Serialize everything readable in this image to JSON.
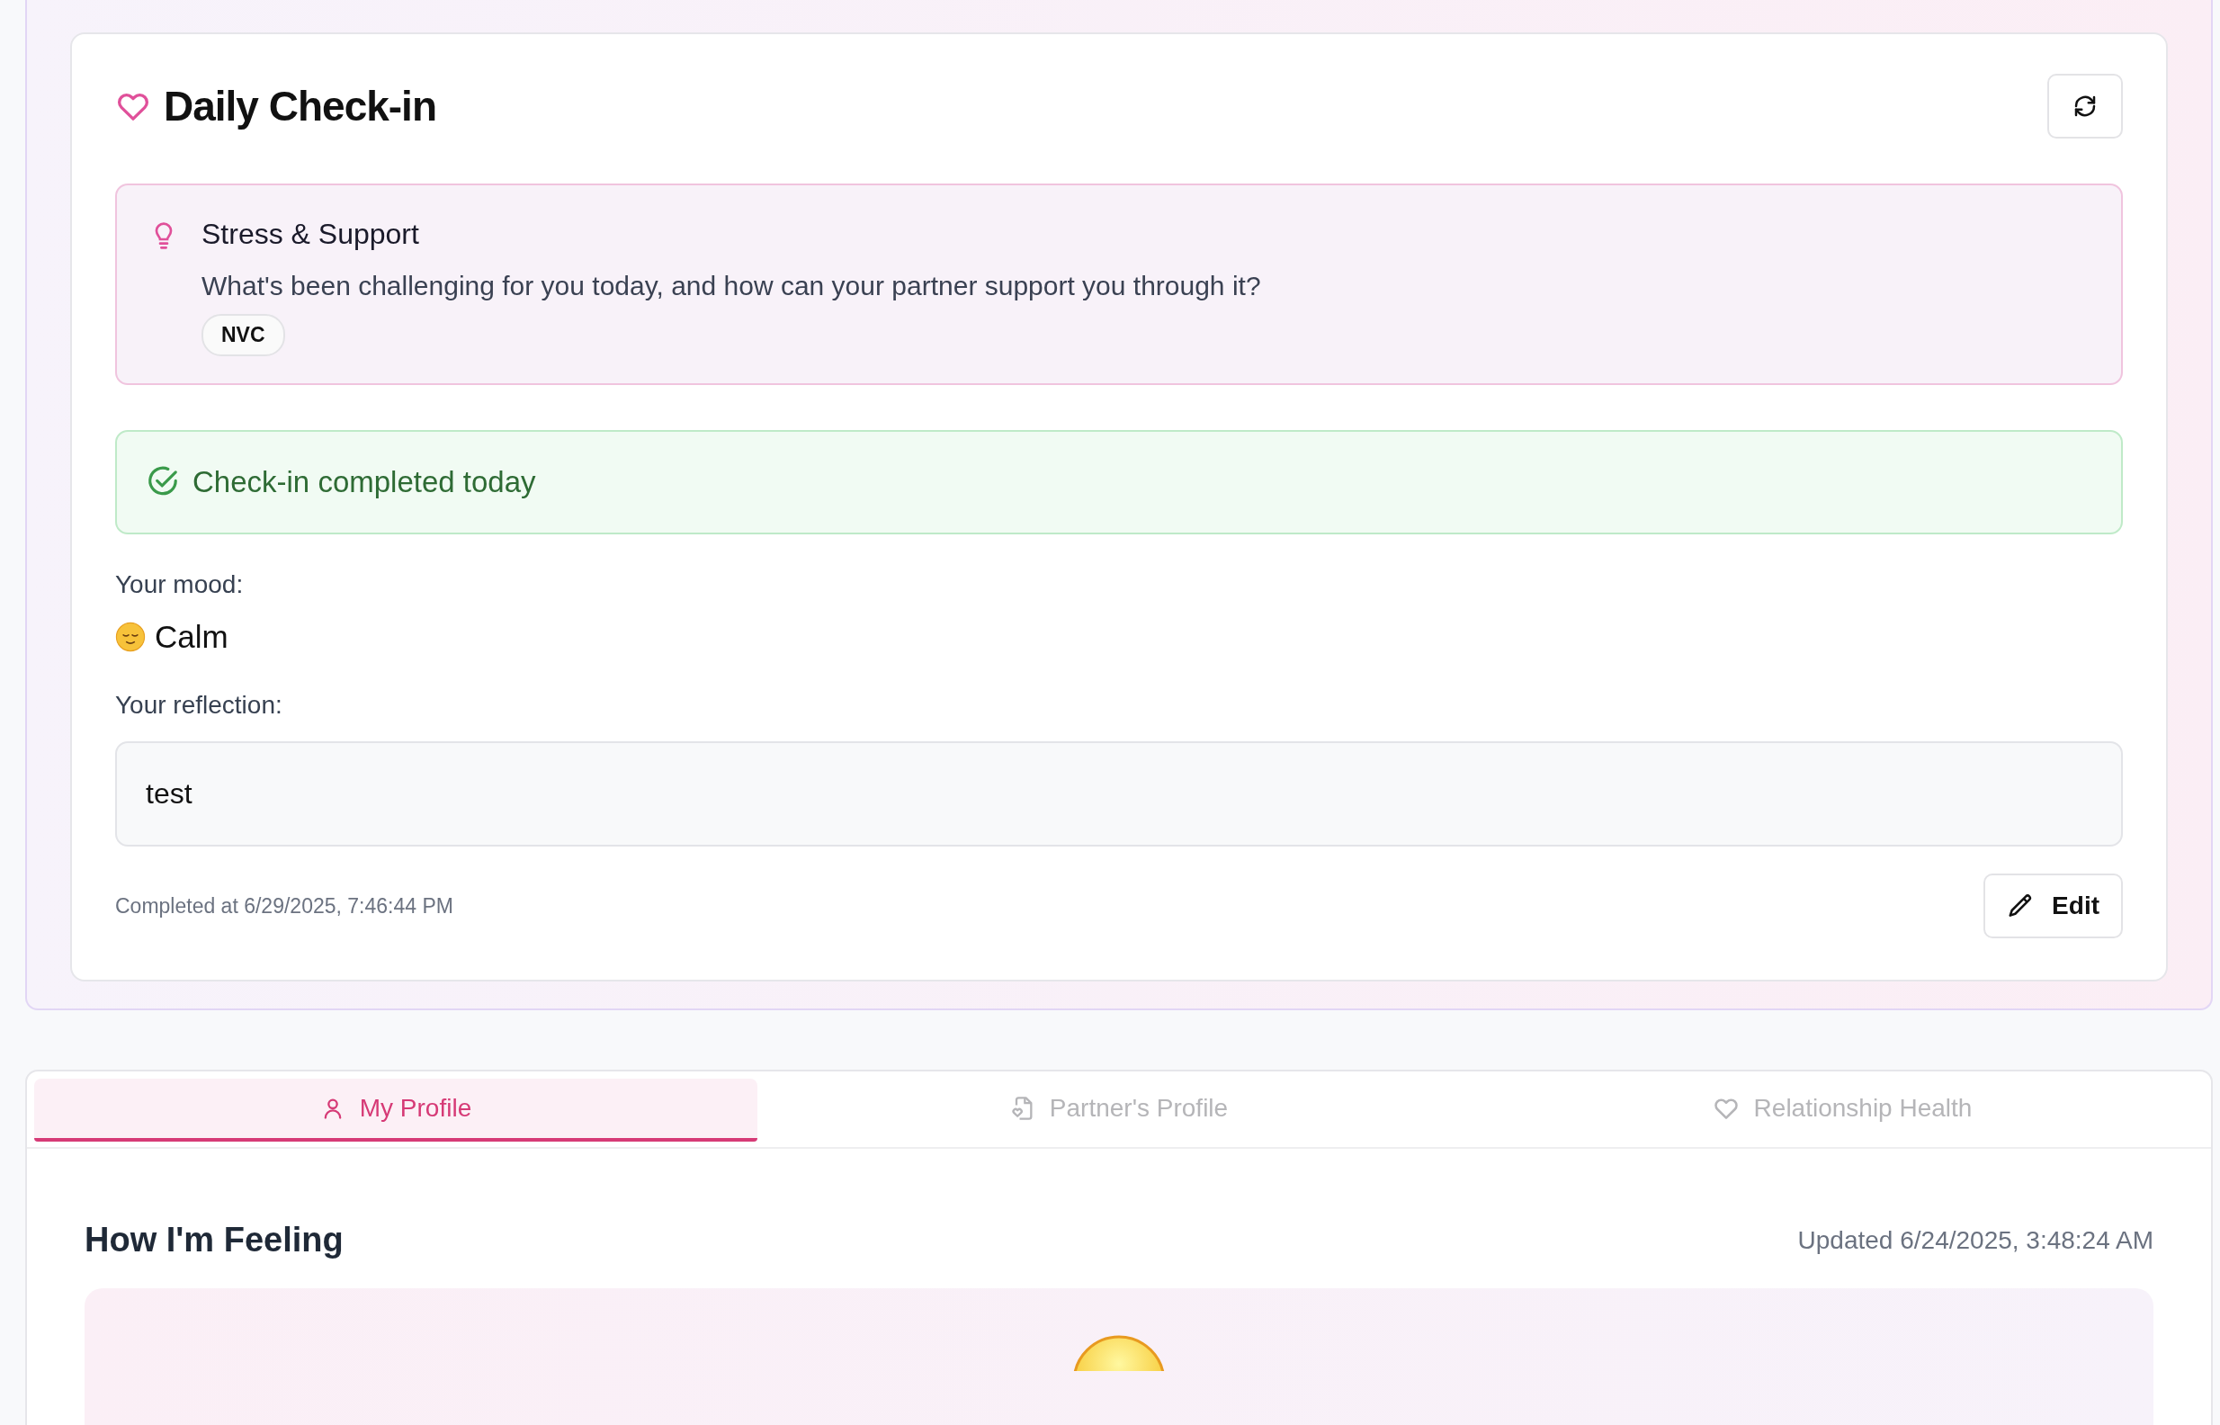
{
  "checkin": {
    "title": "Daily Check-in",
    "prompt": {
      "title": "Stress & Support",
      "question": "What's been challenging for you today, and how can your partner support you through it?",
      "tag": "NVC"
    },
    "status": "Check-in completed today",
    "mood_label": "Your mood:",
    "mood": "Calm",
    "reflection_label": "Your reflection:",
    "reflection": "test",
    "completed_at": "Completed at 6/29/2025, 7:46:44 PM",
    "edit_button": "Edit"
  },
  "tabs": [
    {
      "label": "My Profile",
      "kind": "person",
      "selected": true
    },
    {
      "label": "Partner's Profile",
      "kind": "document",
      "selected": false
    },
    {
      "label": "Relationship Health",
      "kind": "heart",
      "selected": false
    }
  ],
  "feeling": {
    "title": "How I'm Feeling",
    "updated": "Updated 6/24/2025, 3:48:24 AM"
  }
}
